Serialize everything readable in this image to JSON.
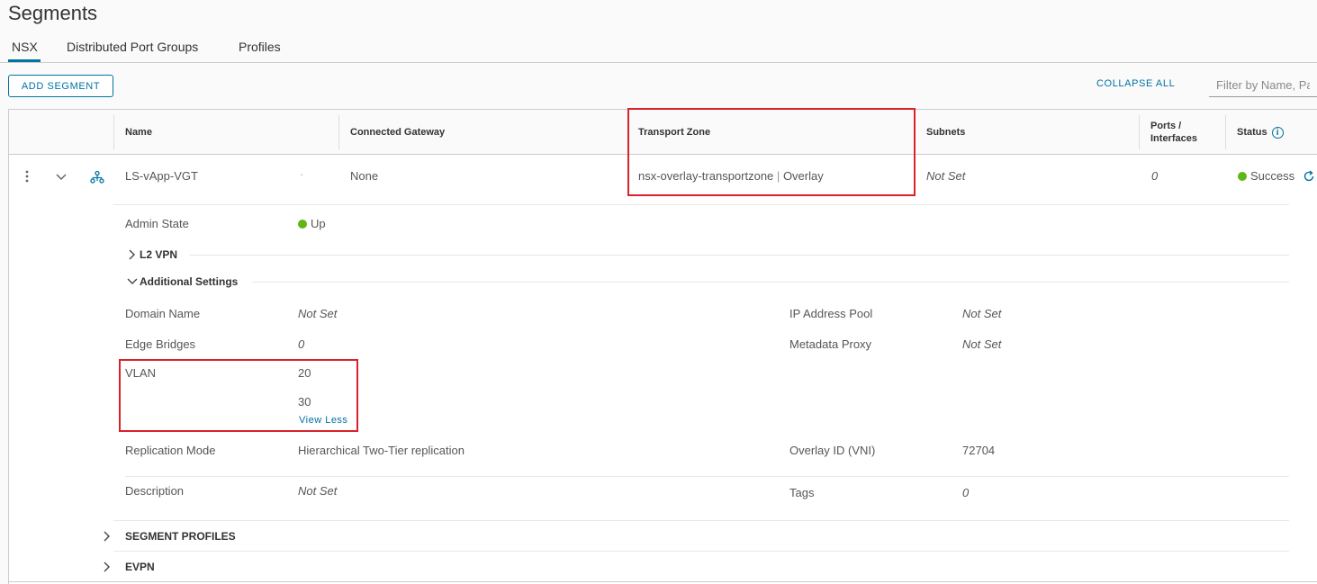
{
  "page": {
    "title": "Segments"
  },
  "tabs": [
    {
      "label": "NSX",
      "active": true
    },
    {
      "label": "Distributed Port Groups",
      "active": false
    },
    {
      "label": "Profiles",
      "active": false
    }
  ],
  "toolbar": {
    "add_label": "ADD SEGMENT",
    "collapse_label": "COLLAPSE ALL",
    "filter_placeholder": "Filter by Name, Path and more"
  },
  "columns": {
    "name": "Name",
    "gateway": "Connected Gateway",
    "transport_zone": "Transport Zone",
    "subnets": "Subnets",
    "ports_1": "Ports /",
    "ports_2": "Interfaces",
    "status": "Status"
  },
  "segment": {
    "name": "LS-vApp-VGT",
    "name_extra": "·",
    "gateway": "None",
    "transport_zone_name": "nsx-overlay-transportzone",
    "transport_zone_sep": "|",
    "transport_zone_type": "Overlay",
    "subnets": "Not Set",
    "ports": "0",
    "status": "Success"
  },
  "details": {
    "admin_state_label": "Admin State",
    "admin_state_value": "Up",
    "l2vpn_label": "L2 VPN",
    "additional_settings_label": "Additional Settings",
    "domain_name_label": "Domain Name",
    "domain_name_value": "Not Set",
    "ip_pool_label": "IP Address Pool",
    "ip_pool_value": "Not Set",
    "edge_bridges_label": "Edge Bridges",
    "edge_bridges_value": "0",
    "metadata_proxy_label": "Metadata Proxy",
    "metadata_proxy_value": "Not Set",
    "vlan_label": "VLAN",
    "vlan_values": [
      "20",
      "30"
    ],
    "view_less": "View Less",
    "replication_label": "Replication Mode",
    "replication_value": "Hierarchical Two-Tier replication",
    "overlay_id_label": "Overlay ID (VNI)",
    "overlay_id_value": "72704",
    "description_label": "Description",
    "description_value": "Not Set",
    "tags_label": "Tags",
    "tags_value": "0",
    "segment_profiles_label": "SEGMENT PROFILES",
    "evpn_label": "EVPN"
  },
  "colors": {
    "accent": "#0072a3",
    "success": "#5eb715",
    "highlight": "#d9222a"
  }
}
